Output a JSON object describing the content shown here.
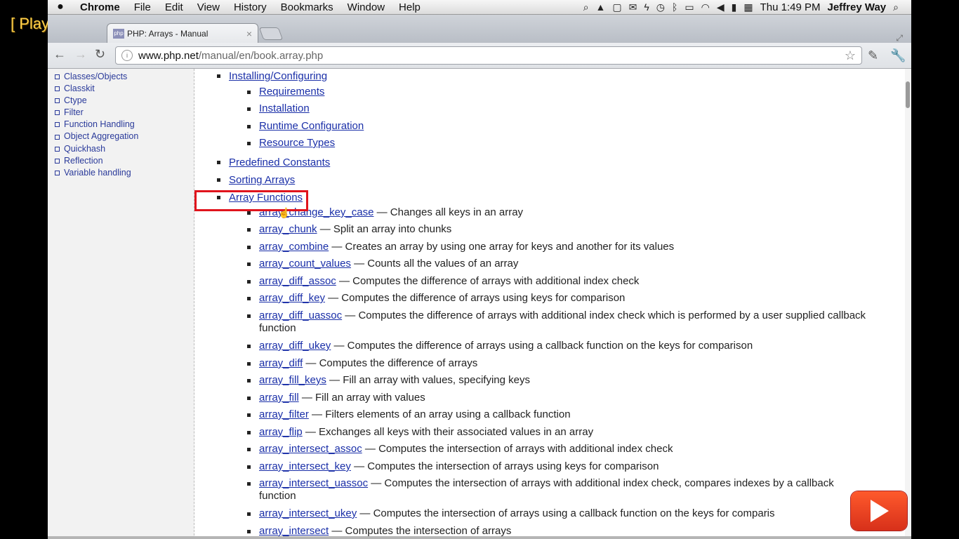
{
  "overlay": {
    "playing_label": "[ Playing ]"
  },
  "menubar": {
    "apple": "",
    "app": "Chrome",
    "items": [
      "File",
      "Edit",
      "View",
      "History",
      "Bookmarks",
      "Window",
      "Help"
    ],
    "clock": "Thu 1:49 PM",
    "user": "Jeffrey Way"
  },
  "browser": {
    "tab_title": "PHP: Arrays - Manual",
    "tab_favicon": "php",
    "url_host": "www.php.net",
    "url_path": "/manual/en/book.array.php"
  },
  "sidebar": {
    "items": [
      "Classes/Objects",
      "Classkit",
      "Ctype",
      "Filter",
      "Function Handling",
      "Object Aggregation",
      "Quickhash",
      "Reflection",
      "Variable handling"
    ]
  },
  "main": {
    "installing": "Installing/Configuring",
    "install_sub": [
      "Requirements",
      "Installation",
      "Runtime Configuration",
      "Resource Types"
    ],
    "predefined": "Predefined Constants",
    "sorting": "Sorting Arrays",
    "array_functions": "Array Functions",
    "functions": [
      {
        "name": "array_change_key_case",
        "desc": " — Changes all keys in an array"
      },
      {
        "name": "array_chunk",
        "desc": " — Split an array into chunks"
      },
      {
        "name": "array_combine",
        "desc": " — Creates an array by using one array for keys and another for its values"
      },
      {
        "name": "array_count_values",
        "desc": " — Counts all the values of an array"
      },
      {
        "name": "array_diff_assoc",
        "desc": " — Computes the difference of arrays with additional index check"
      },
      {
        "name": "array_diff_key",
        "desc": " — Computes the difference of arrays using keys for comparison"
      },
      {
        "name": "array_diff_uassoc",
        "desc": " — Computes the difference of arrays with additional index check which is performed by a user supplied callback function"
      },
      {
        "name": "array_diff_ukey",
        "desc": " — Computes the difference of arrays using a callback function on the keys for comparison"
      },
      {
        "name": "array_diff",
        "desc": " — Computes the difference of arrays"
      },
      {
        "name": "array_fill_keys",
        "desc": " — Fill an array with values, specifying keys"
      },
      {
        "name": "array_fill",
        "desc": " — Fill an array with values"
      },
      {
        "name": "array_filter",
        "desc": " — Filters elements of an array using a callback function"
      },
      {
        "name": "array_flip",
        "desc": " — Exchanges all keys with their associated values in an array"
      },
      {
        "name": "array_intersect_assoc",
        "desc": " — Computes the intersection of arrays with additional index check"
      },
      {
        "name": "array_intersect_key",
        "desc": " — Computes the intersection of arrays using keys for comparison"
      },
      {
        "name": "array_intersect_uassoc",
        "desc": " — Computes the intersection of arrays with additional index check, compares indexes by a callback function"
      },
      {
        "name": "array_intersect_ukey",
        "desc": " — Computes the intersection of arrays using a callback function on the keys for comparis"
      },
      {
        "name": "array_intersect",
        "desc": " — Computes the intersection of arrays"
      }
    ]
  }
}
